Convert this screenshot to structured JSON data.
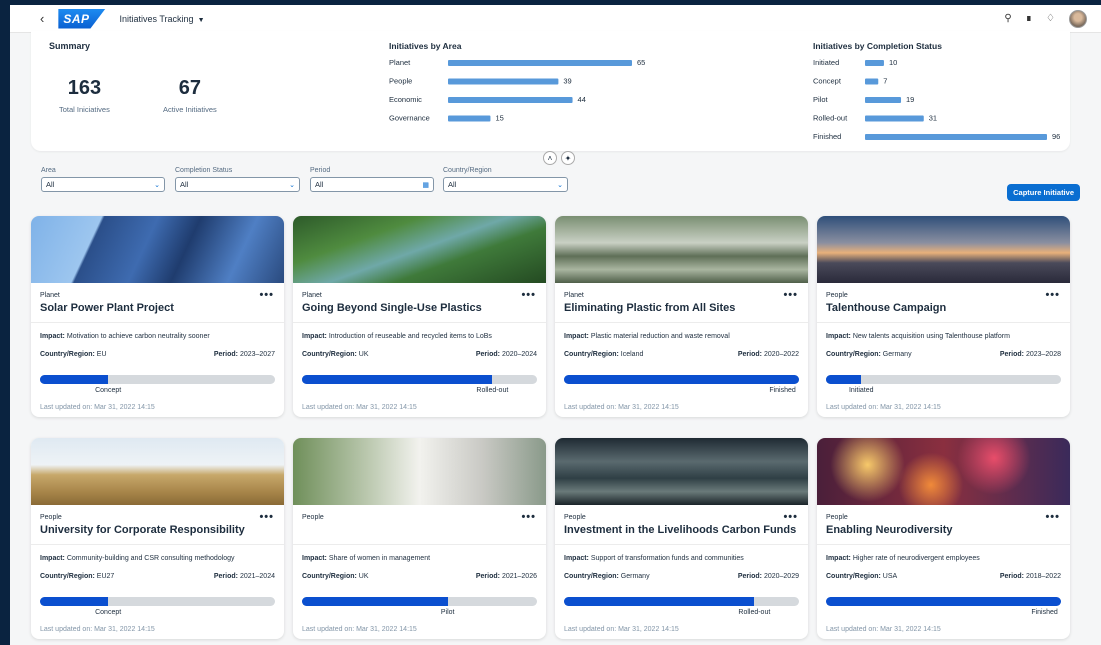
{
  "shell": {
    "back_icon": "chevron-left-icon",
    "logo": "SAP",
    "app_title": "Initiatives Tracking",
    "icons": [
      "search-icon",
      "copilot-icon",
      "notification-bell-icon",
      "user-avatar"
    ]
  },
  "summary": {
    "title": "Summary",
    "total_value": "163",
    "total_label": "Total Iniciatives",
    "active_value": "67",
    "active_label": "Active Initiatives"
  },
  "chart_data": [
    {
      "type": "bar",
      "orientation": "horizontal",
      "title": "Initiatives by Area",
      "categories": [
        "Planet",
        "People",
        "Economic",
        "Governance"
      ],
      "values": [
        65,
        39,
        44,
        15
      ],
      "color": "#5899da"
    },
    {
      "type": "bar",
      "orientation": "horizontal",
      "title": "Initiatives by Completion Status",
      "categories": [
        "Initiated",
        "Concept",
        "Pilot",
        "Rolled-out",
        "Finished"
      ],
      "values": [
        10,
        7,
        19,
        31,
        96
      ],
      "color": "#5899da"
    }
  ],
  "filters": {
    "area": {
      "label": "Area",
      "value": "All"
    },
    "status": {
      "label": "Completion Status",
      "value": "All"
    },
    "period": {
      "label": "Period",
      "value": "All"
    },
    "country": {
      "label": "Country/Region",
      "value": "All"
    },
    "capture_label": "Capture Initiative"
  },
  "labels": {
    "impact": "Impact:",
    "country": "Country/Region:",
    "period": "Period:"
  },
  "colors": {
    "accent": "#0a6ed1",
    "progress": "#0b4fcf",
    "track": "#d5d9dd"
  },
  "cards": [
    {
      "area": "Planet",
      "title": "Solar Power Plant Project",
      "impact": "Motivation to achieve carbon neutrality sooner",
      "country": "EU",
      "period": "2023–2027",
      "stage": "Concept",
      "progress": 0.29,
      "updated": "Last updated on: Mar 31, 2022 14:15",
      "image": "solar-panels-image"
    },
    {
      "area": "Planet",
      "title": "Going Beyond Single-Use Plastics",
      "impact": "Introduction of reuseable and recycled items to LoBs",
      "country": "UK",
      "period": "2020–2024",
      "stage": "Rolled-out",
      "progress": 0.81,
      "updated": "Last updated on: Mar 31, 2022 14:15",
      "image": "forest-river-image"
    },
    {
      "area": "Planet",
      "title": "Eliminating Plastic from All Sites",
      "impact": "Plastic material reduction and waste removal",
      "country": "Iceland",
      "period": "2020–2022",
      "stage": "Finished",
      "progress": 1.0,
      "updated": "Last updated on: Mar 31, 2022 14:15",
      "image": "plastic-crates-image"
    },
    {
      "area": "People",
      "title": "Talenthouse Campaign",
      "impact": "New talents acquisition using Talenthouse platform",
      "country": "Germany",
      "period": "2023–2028",
      "stage": "Initiated",
      "progress": 0.15,
      "updated": "Last updated on: Mar 31, 2022 14:15",
      "image": "city-skyline-image"
    },
    {
      "area": "People",
      "title": "University for Corporate Responsibility",
      "impact": "Community-building and CSR consulting methodology",
      "country": "EU27",
      "period": "2021–2024",
      "stage": "Concept",
      "progress": 0.29,
      "updated": "Last updated on: Mar 31, 2022 14:15",
      "image": "children-field-image"
    },
    {
      "area": "People",
      "title": "",
      "impact": "Share of women in management",
      "country": "UK",
      "period": "2021–2026",
      "stage": "Pilot",
      "progress": 0.62,
      "updated": "Last updated on: Mar 31, 2022 14:15",
      "image": "colleagues-image"
    },
    {
      "area": "People",
      "title": "Investment in the Livelihoods Carbon Funds",
      "impact": "Support of transformation funds and communities",
      "country": "Germany",
      "period": "2020–2029",
      "stage": "Rolled-out",
      "progress": 0.81,
      "updated": "Last updated on: Mar 31, 2022 14:15",
      "image": "greenhouse-image"
    },
    {
      "area": "People",
      "title": "Enabling Neurodiversity",
      "impact": "Higher rate of neurodivergent employees",
      "country": "USA",
      "period": "2018–2022",
      "stage": "Finished",
      "progress": 1.0,
      "updated": "Last updated on: Mar 31, 2022 14:15",
      "image": "bokeh-lights-image"
    }
  ]
}
